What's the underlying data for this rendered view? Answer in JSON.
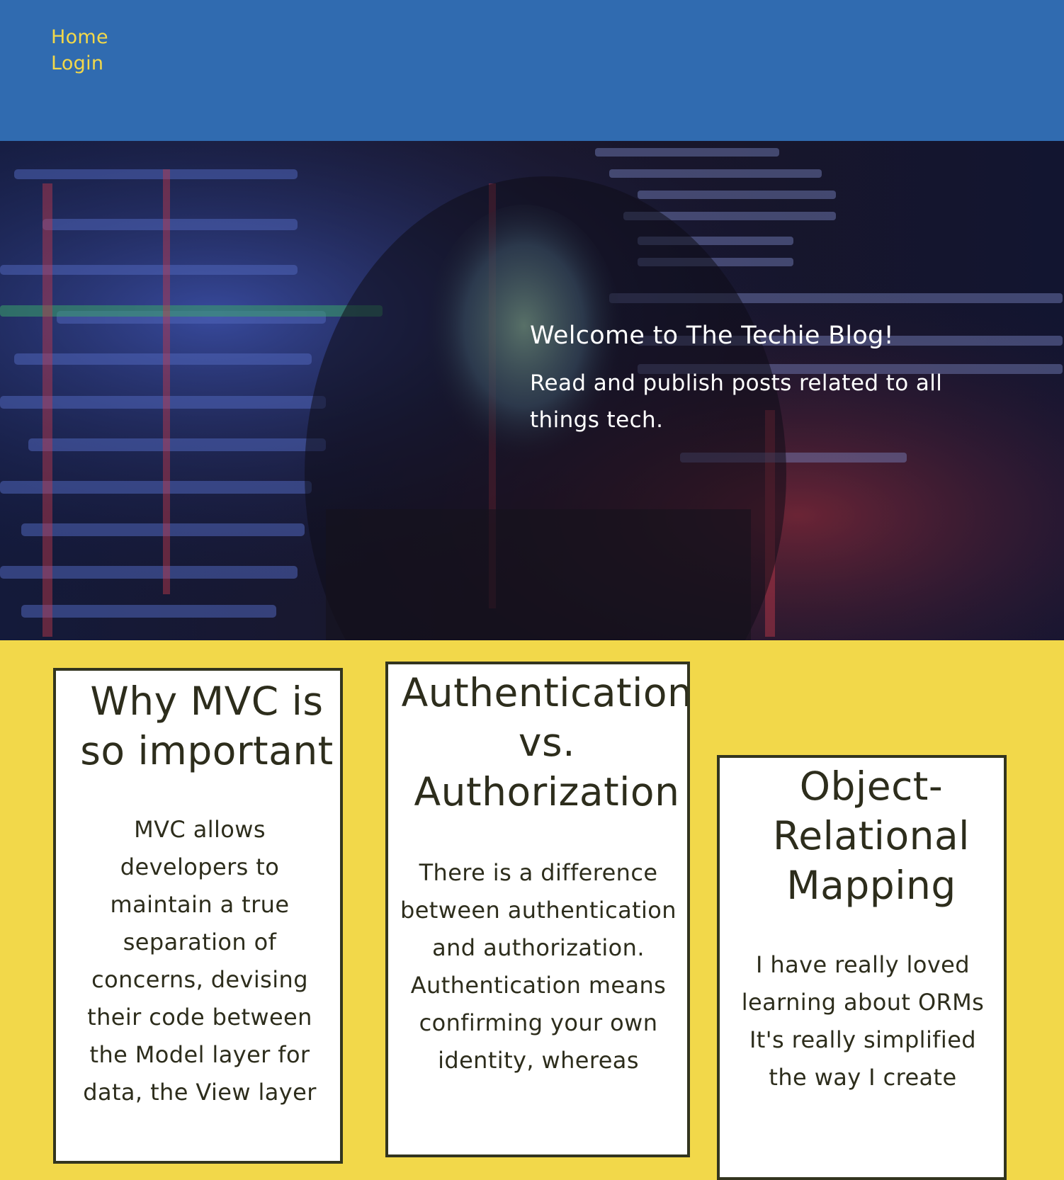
{
  "nav": {
    "home_label": "Home",
    "login_label": "Login"
  },
  "hero": {
    "title": "Welcome to The Techie Blog!",
    "subtitle": "Read and publish posts related to all things tech."
  },
  "posts": [
    {
      "title": "Why MVC is so important",
      "excerpt": "MVC allows developers to maintain a true separation of concerns, devising their code between the Model layer for data, the View layer"
    },
    {
      "title": "Authentication vs. Authorization",
      "excerpt": "There is a difference between authentication and authorization. Authentication means confirming your own identity, whereas"
    },
    {
      "title": "Object-Relational Mapping",
      "excerpt": "I have really loved learning about ORMs It's really simplified the way I create"
    }
  ],
  "colors": {
    "header_bg": "#306bb0",
    "accent_yellow": "#f2d84a",
    "card_border": "#33351f",
    "text_dark": "#2d2d1c"
  }
}
